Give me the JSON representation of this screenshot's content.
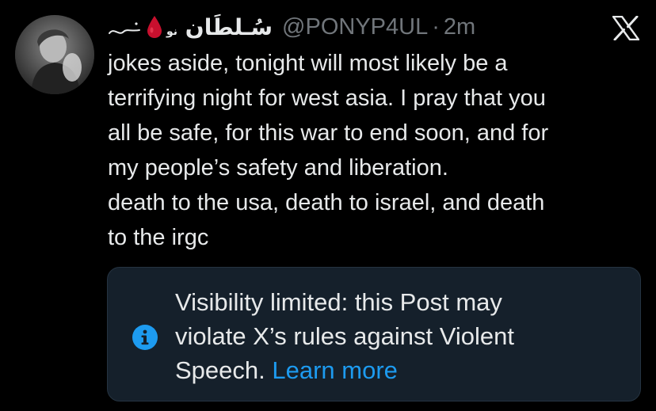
{
  "post": {
    "author": {
      "display_name": "سُـلطَان",
      "display_name_suffix": "نو",
      "handle": "@PONYP4UL",
      "separator": "·",
      "timestamp": "2m",
      "avatar_icon": "avatar-photo",
      "blood_drop_icon": "drop-of-blood-icon"
    },
    "platform_logo": "x-logo-icon",
    "body_lines": [
      "jokes aside, tonight will most likely be a",
      "terrifying night for west asia. I pray that you",
      "all be safe, for this war to end soon, and for",
      "my people’s safety and liberation.",
      "death to the usa, death to israel, and death",
      "to the irgc"
    ],
    "notice": {
      "icon": "info-icon",
      "lines": [
        "Visibility limited: this Post may",
        "violate X’s rules against Violent",
        "Speech."
      ],
      "link_label": "Learn more"
    }
  },
  "colors": {
    "background": "#000000",
    "text": "#e7e9ea",
    "muted": "#71767b",
    "accent": "#1d9bf0",
    "notice_bg": "#15202b",
    "blood": "#c8102e"
  }
}
